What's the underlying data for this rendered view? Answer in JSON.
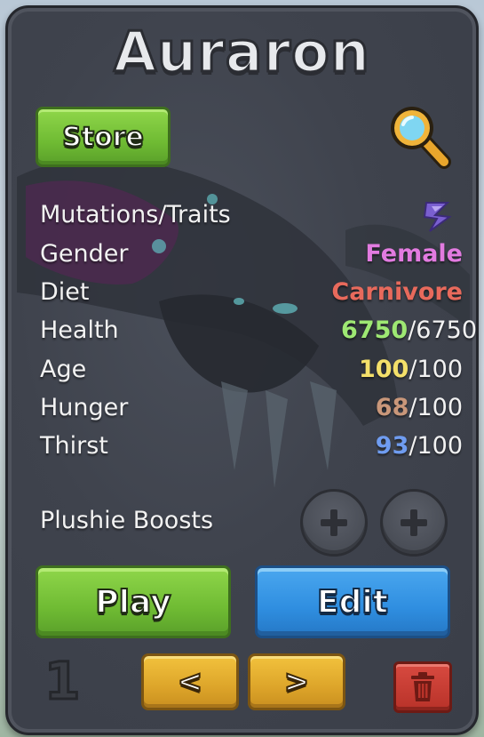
{
  "card": {
    "title": "Auraron",
    "store_label": "Store",
    "slot_number": "1"
  },
  "stats": {
    "mutations_label": "Mutations/Traits",
    "gender_label": "Gender",
    "gender_value": "Female",
    "diet_label": "Diet",
    "diet_value": "Carnivore",
    "health_label": "Health",
    "health_current": "6750",
    "health_max": "/6750",
    "age_label": "Age",
    "age_current": "100",
    "age_max": "/100",
    "hunger_label": "Hunger",
    "hunger_current": "68",
    "hunger_max": "/100",
    "thirst_label": "Thirst",
    "thirst_current": "93",
    "thirst_max": "/100"
  },
  "boosts": {
    "label": "Plushie Boosts",
    "slot_symbol": "+"
  },
  "actions": {
    "play_label": "Play",
    "edit_label": "Edit",
    "prev_label": "<",
    "next_label": ">"
  },
  "colors": {
    "gender": "#e27be0",
    "diet": "#e86a5c",
    "health": "#9ee873",
    "age": "#f4e06a",
    "hunger": "#c9977a",
    "thirst": "#6f9cf0"
  },
  "icons": {
    "search": "magnifying-glass-icon",
    "mutations": "mutation-crystal-icon",
    "boost": "plus-icon",
    "delete": "trash-icon"
  }
}
